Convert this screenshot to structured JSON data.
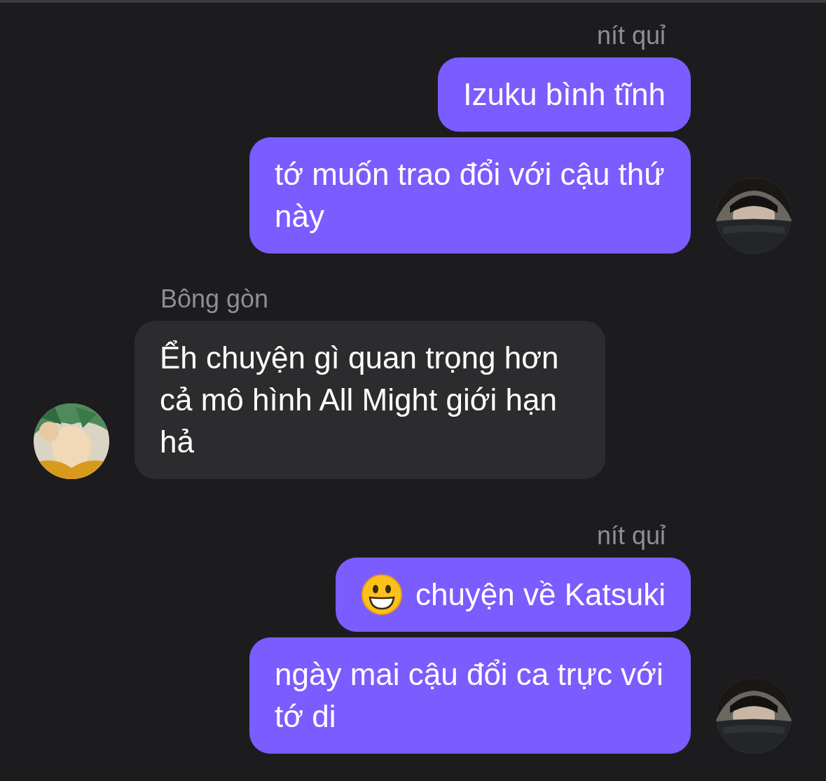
{
  "groups": [
    {
      "kind": "outgoing",
      "sender": "nít quỉ",
      "avatar": {
        "kind": "picture"
      },
      "messages": [
        {
          "kind": "text",
          "text": "Izuku bình tĩnh"
        },
        {
          "kind": "text",
          "text": "tớ muốn trao đổi với cậu thứ này"
        }
      ]
    },
    {
      "kind": "incoming",
      "sender": "Bông gòn",
      "avatar": {
        "kind": "picture"
      },
      "messages": [
        {
          "kind": "text",
          "text": "Ểh chuyện gì quan trọng hơn cả mô hình All Might giới hạn hả"
        }
      ]
    },
    {
      "kind": "outgoing",
      "sender": "nít quỉ",
      "avatar": {
        "kind": "picture"
      },
      "messages": [
        {
          "kind": "with_emoji",
          "text": "chuyện về Katsuki"
        },
        {
          "kind": "text",
          "text": "ngày mai cậu đổi ca trực với tớ di"
        }
      ]
    }
  ]
}
